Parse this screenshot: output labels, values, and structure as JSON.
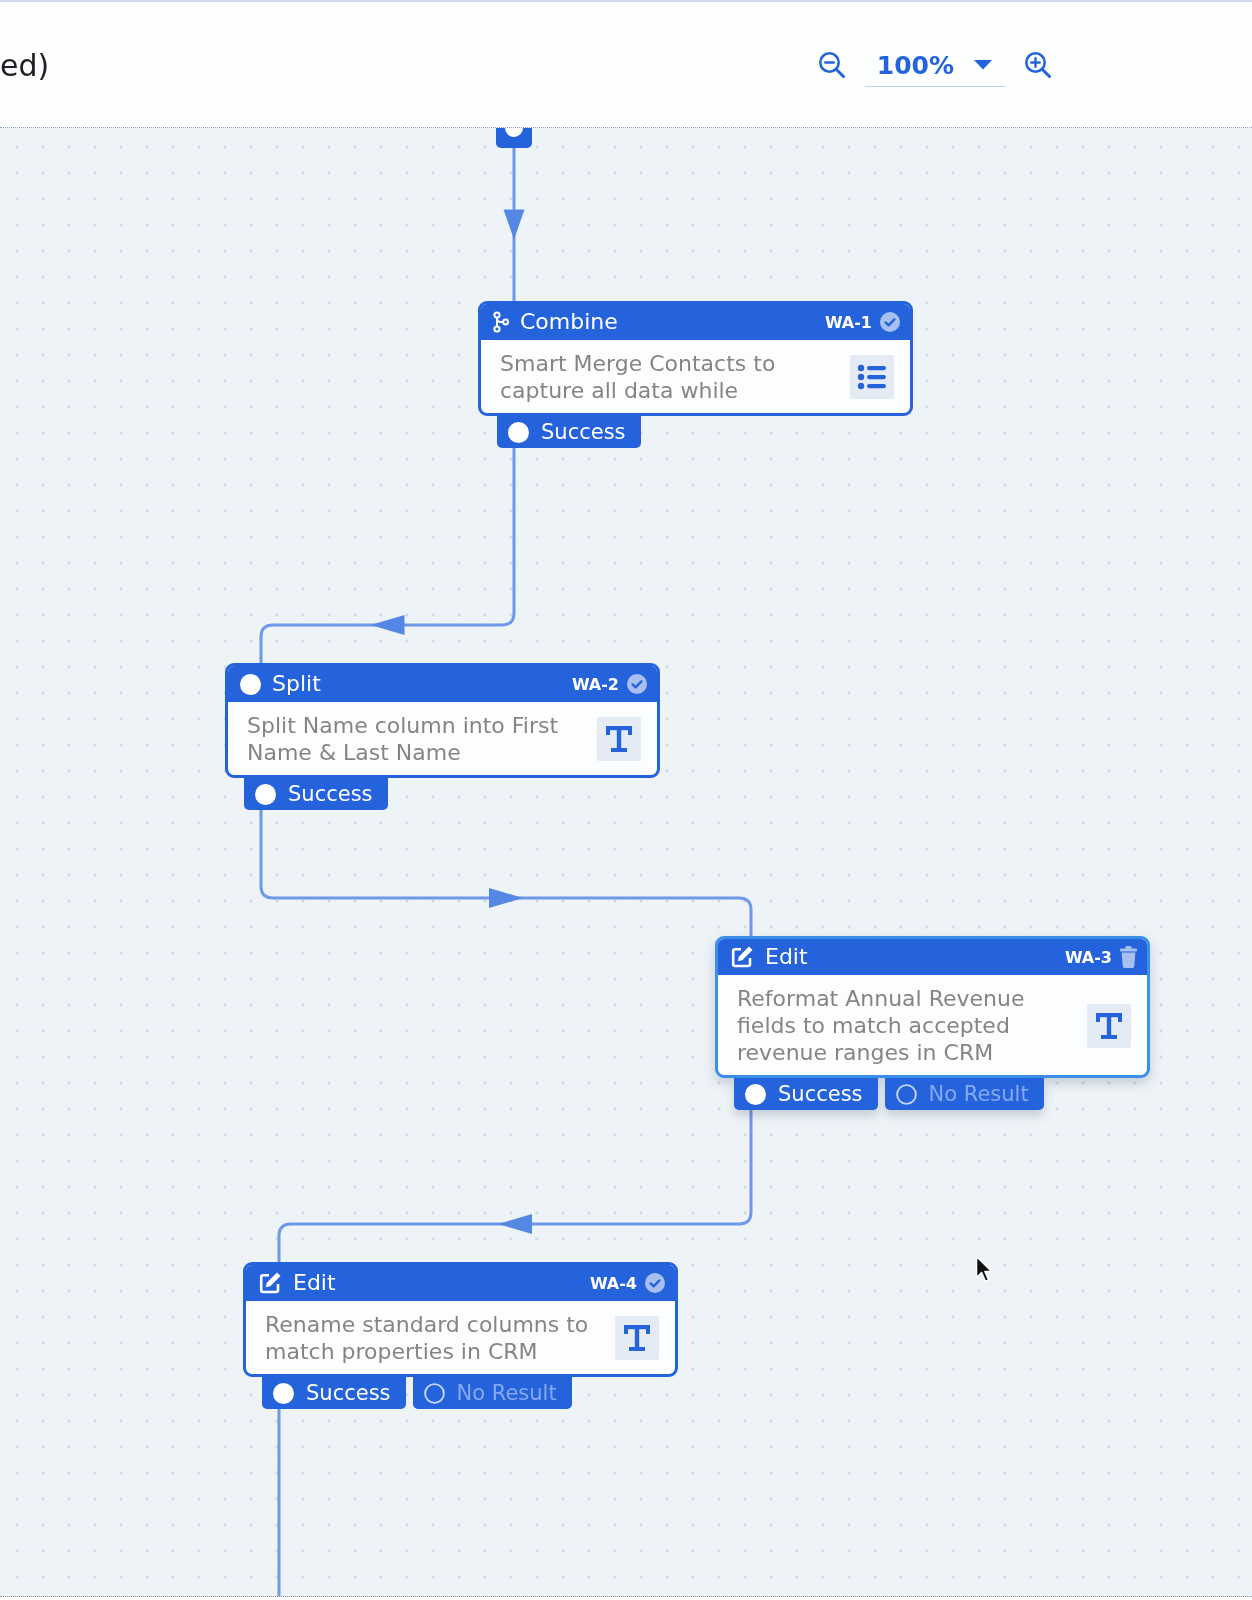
{
  "toolbar": {
    "title": "ed)",
    "zoom": {
      "value": "100%"
    }
  },
  "canvas": {
    "nodes": [
      {
        "kind": "combine",
        "title": "Combine",
        "id_label": "WA-1",
        "selected": false,
        "description": "Smart Merge Contacts to capture all data while",
        "ports": [
          {
            "label": "Success",
            "active": true
          }
        ]
      },
      {
        "kind": "split",
        "title": "Split",
        "id_label": "WA-2",
        "selected": false,
        "description": "Split Name column into First Name & Last Name",
        "ports": [
          {
            "label": "Success",
            "active": true
          }
        ]
      },
      {
        "kind": "edit",
        "title": "Edit",
        "id_label": "WA-3",
        "selected": true,
        "description": "Reformat Annual Revenue fields to match accepted revenue ranges in CRM",
        "ports": [
          {
            "label": "Success",
            "active": true
          },
          {
            "label": "No Result",
            "active": false
          }
        ]
      },
      {
        "kind": "edit",
        "title": "Edit",
        "id_label": "WA-4",
        "selected": false,
        "description": "Rename standard columns to match properties in CRM",
        "ports": [
          {
            "label": "Success",
            "active": true
          },
          {
            "label": "No Result",
            "active": false
          }
        ]
      }
    ]
  }
}
